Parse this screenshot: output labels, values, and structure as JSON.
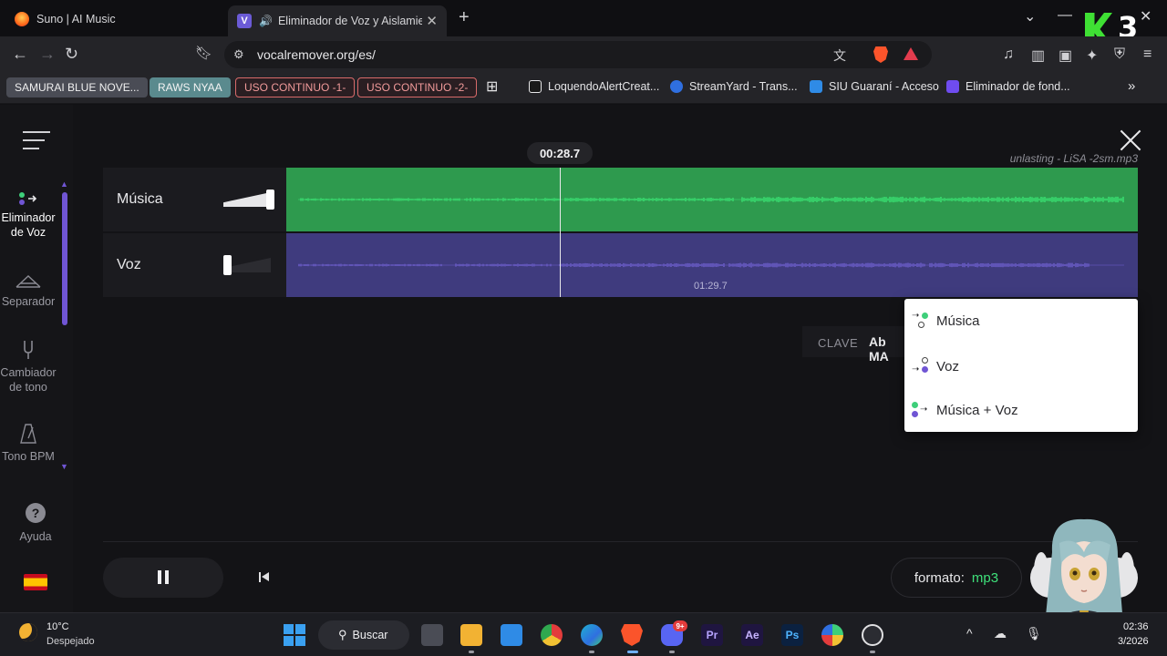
{
  "browser": {
    "tabs": [
      {
        "title": "Suno | AI Music"
      },
      {
        "title": "Eliminador de Voz y Aislamien",
        "audio_icon": "speaker-icon"
      }
    ],
    "url": "vocalremover.org/es/"
  },
  "bookmarks": {
    "chips": [
      "SAMURAI BLUE NOVE...",
      "RAWS NYAA",
      "USO CONTINUO -1-",
      "USO CONTINUO -2-"
    ],
    "items": [
      {
        "label": "LoquendoAlertCreat...",
        "icon_color": "#e8e8ea"
      },
      {
        "label": "StreamYard - Trans...",
        "icon_color": "#2f6fe0"
      },
      {
        "label": "SIU Guaraní - Acceso",
        "icon_color": "#2f8be6"
      },
      {
        "label": "Eliminador de fond...",
        "icon_color": "#6f4cf0"
      }
    ]
  },
  "sidebar": {
    "items": [
      {
        "label": "Eliminador de Voz",
        "active": true
      },
      {
        "label": "Separador",
        "active": false
      },
      {
        "label": "Cambiador de tono",
        "active": false
      },
      {
        "label": "Tono BPM",
        "active": false
      },
      {
        "label": "Ayuda",
        "active": false
      }
    ]
  },
  "player": {
    "current_time": "00:28.7",
    "filename": "unlasting - LiSA -2sm.mp3",
    "duration": "01:29.7",
    "playhead_fraction": 0.3208,
    "tracks": [
      {
        "name": "Música",
        "volume": 1.0,
        "color": "#2e9a4e",
        "wave_color": "#3cf07a"
      },
      {
        "name": "Voz",
        "volume": 0.0,
        "color": "#3f3b7e",
        "wave_color": "#7766dd"
      }
    ]
  },
  "key": {
    "label": "CLAVE",
    "value": "Ab MA"
  },
  "export_menu": {
    "items": [
      "Música",
      "Voz",
      "Música + Voz"
    ]
  },
  "format": {
    "label": "formato:",
    "value": "mp3"
  },
  "overlay": {
    "brand": "3"
  },
  "taskbar": {
    "weather_temp": "10°C",
    "weather_desc": "Despejado",
    "search": "Buscar",
    "badge": "9+",
    "apps": [
      "Pr",
      "Ae",
      "Ps"
    ],
    "time": "02:36",
    "date": "3/2026"
  },
  "colors": {
    "accent": "#7055d4",
    "format_value": "#3ee07a"
  }
}
